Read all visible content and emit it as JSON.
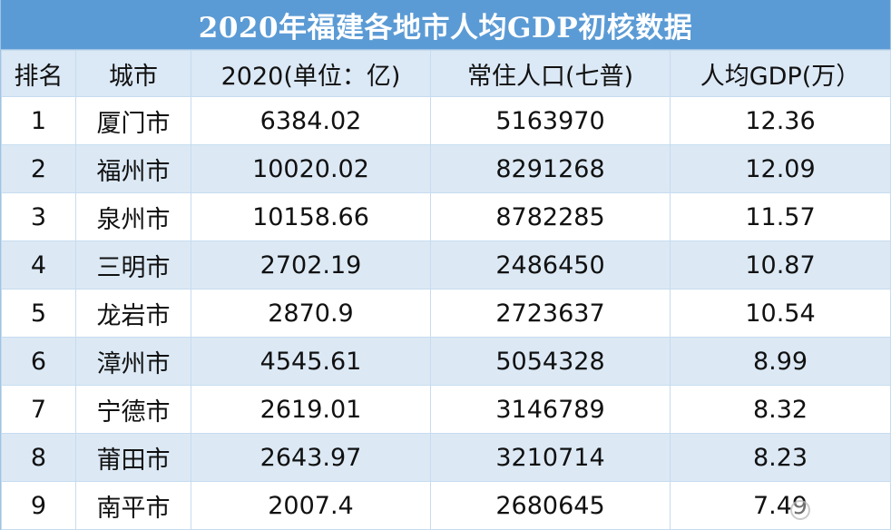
{
  "title": "2020年福建各地市人均GDP初核数据",
  "headers": {
    "rank": "排名",
    "city": "城市",
    "gdp": "2020(单位：亿)",
    "population": "常住人口(七普)",
    "per_capita": "人均GDP(万）"
  },
  "rows": [
    {
      "rank": "1",
      "city": "厦门市",
      "gdp": "6384.02",
      "population": "5163970",
      "per_capita": "12.36"
    },
    {
      "rank": "2",
      "city": "福州市",
      "gdp": "10020.02",
      "population": "8291268",
      "per_capita": "12.09"
    },
    {
      "rank": "3",
      "city": "泉州市",
      "gdp": "10158.66",
      "population": "8782285",
      "per_capita": "11.57"
    },
    {
      "rank": "4",
      "city": "三明市",
      "gdp": "2702.19",
      "population": "2486450",
      "per_capita": "10.87"
    },
    {
      "rank": "5",
      "city": "龙岩市",
      "gdp": "2870.9",
      "population": "2723637",
      "per_capita": "10.54"
    },
    {
      "rank": "6",
      "city": "漳州市",
      "gdp": "4545.61",
      "population": "5054328",
      "per_capita": "8.99"
    },
    {
      "rank": "7",
      "city": "宁德市",
      "gdp": "2619.01",
      "population": "3146789",
      "per_capita": "8.32"
    },
    {
      "rank": "8",
      "city": "莆田市",
      "gdp": "2643.97",
      "population": "3210714",
      "per_capita": "8.23"
    },
    {
      "rank": "9",
      "city": "南平市",
      "gdp": "2007.4",
      "population": "2680645",
      "per_capita": "7.49"
    }
  ]
}
